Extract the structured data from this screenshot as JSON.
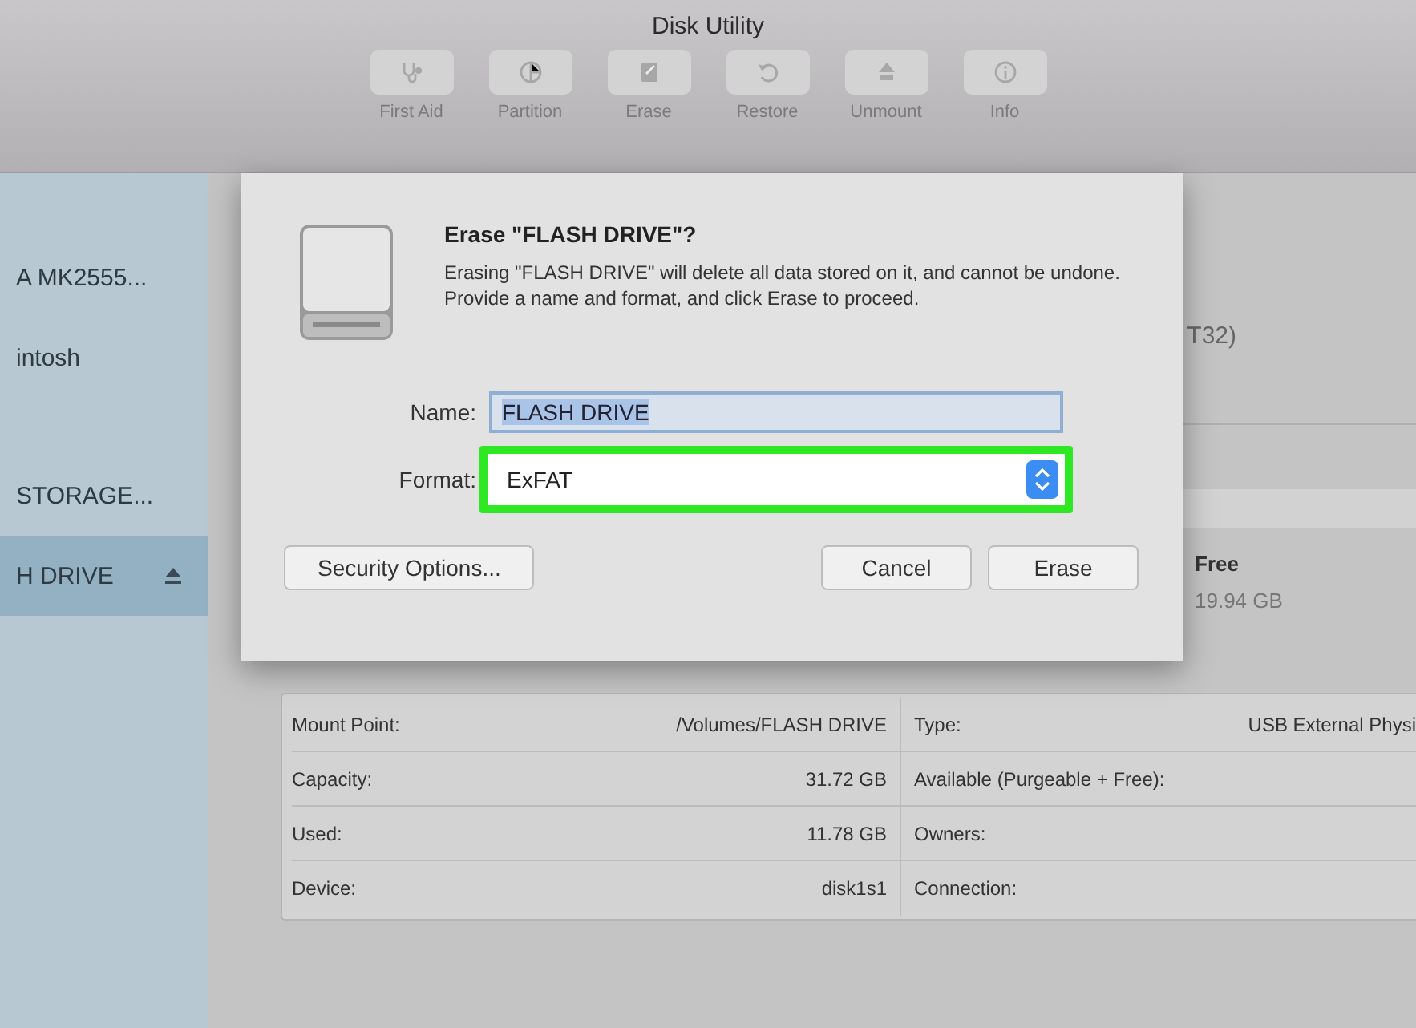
{
  "window": {
    "title": "Disk Utility"
  },
  "toolbar": [
    {
      "label": "First Aid",
      "kind": "firstaid"
    },
    {
      "label": "Partition",
      "kind": "partition"
    },
    {
      "label": "Erase",
      "kind": "erase"
    },
    {
      "label": "Restore",
      "kind": "restore"
    },
    {
      "label": "Unmount",
      "kind": "unmount"
    },
    {
      "label": "Info",
      "kind": "info"
    }
  ],
  "sidebar": {
    "items": [
      {
        "label": "A MK2555...",
        "selected": false,
        "eject": false
      },
      {
        "label": "intosh",
        "selected": false,
        "eject": false
      },
      {
        "label": "STORAGE...",
        "selected": false,
        "eject": false
      },
      {
        "label": "H DRIVE",
        "selected": true,
        "eject": true
      }
    ]
  },
  "background": {
    "format_fragment": "T32)",
    "free_label": "Free",
    "free_value": "19.94 GB"
  },
  "dialog": {
    "title": "Erase \"FLASH DRIVE\"?",
    "message": "Erasing \"FLASH DRIVE\" will delete all data stored on it, and cannot be undone. Provide a name and format, and click Erase to proceed.",
    "name_label": "Name:",
    "name_value": "FLASH DRIVE",
    "format_label": "Format:",
    "format_value": "ExFAT",
    "format_highlighted": true,
    "buttons": [
      {
        "label": "Security Options...",
        "kind": "left"
      },
      {
        "label": "Cancel",
        "kind": "right"
      },
      {
        "label": "Erase",
        "kind": "right"
      }
    ]
  },
  "info": {
    "rows": [
      {
        "label": "Mount Point:",
        "value": "/Volumes/FLASH DRIVE",
        "label_2": "Type:",
        "value_2": "USB External Physi"
      },
      {
        "label": "Capacity:",
        "value": "31.72 GB",
        "label_2": "Available (Purgeable + Free):"
      },
      {
        "label": "Used:",
        "value": "11.78 GB",
        "label_2": "Owners:"
      },
      {
        "label": "Device:",
        "value": "disk1s1",
        "label_2": "Connection:"
      }
    ]
  }
}
